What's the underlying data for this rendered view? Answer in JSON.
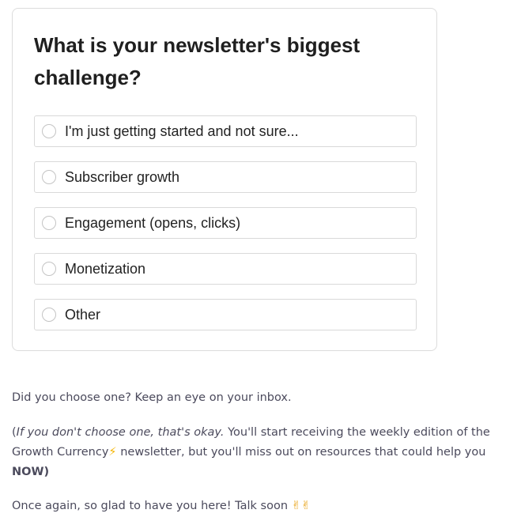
{
  "survey": {
    "question": "What is your newsletter's biggest challenge?",
    "options": [
      {
        "label": "I'm just getting started and not sure..."
      },
      {
        "label": "Subscriber growth"
      },
      {
        "label": "Engagement (opens, clicks)"
      },
      {
        "label": "Monetization"
      },
      {
        "label": "Other"
      }
    ]
  },
  "message": {
    "p1": "Did you choose one? Keep an eye on your inbox.",
    "p2_open_paren": "(",
    "p2_italic": "If you don't choose one, that's okay.",
    "p2_text_a": " You'll start receiving the weekly edition of the Growth Currency",
    "p2_emoji": "⚡",
    "p2_text_b": " newsletter, but you'll miss out on resources that could help you ",
    "p2_bold": "NOW)",
    "p3_text": "Once again, so glad to have you here! Talk soon ",
    "p3_emoji": "✌✌"
  },
  "colors": {
    "text": "#4b4a5c",
    "heading": "#1f1f1f",
    "border": "#d9d9d9"
  },
  "icons": {
    "radio": "radio-unchecked-icon",
    "bolt": "lightning-bolt-emoji",
    "victory": "victory-hand-emoji"
  }
}
